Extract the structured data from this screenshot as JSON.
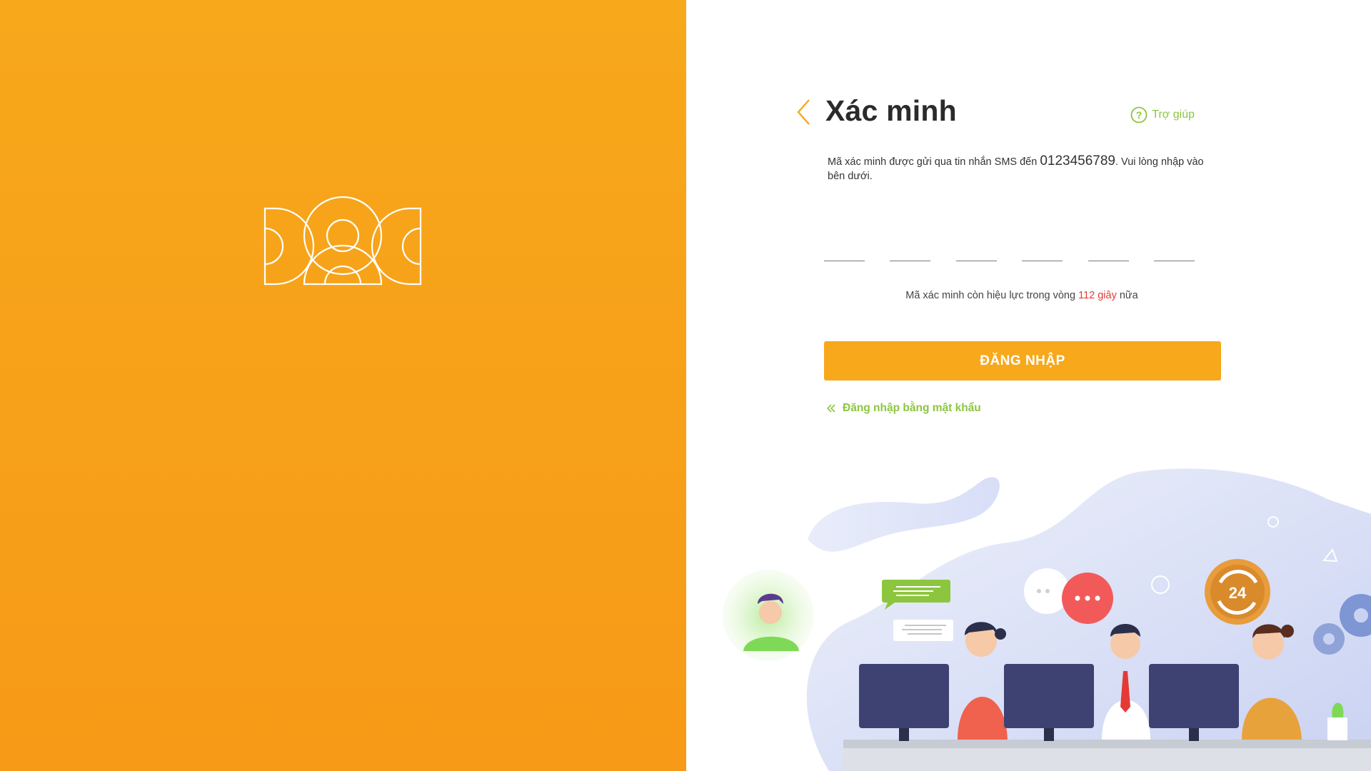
{
  "header": {
    "title": "Xác minh",
    "help_label": "Trợ giúp"
  },
  "message": {
    "before_phone": "Mã xác minh được gửi qua tin nhắn SMS đến ",
    "phone": "0123456789",
    "after_phone": ". Vui lòng nhập vào bên dưới."
  },
  "otp": {
    "digits": [
      "",
      "",
      "",
      "",
      "",
      ""
    ]
  },
  "timer": {
    "prefix": "Mã xác minh còn hiệu lực trong vòng ",
    "seconds": "112 giây",
    "suffix": " nữa"
  },
  "login_button": "ĐĂNG NHẬP",
  "password_link": "Đăng nhập bằng mật khẩu",
  "colors": {
    "brand_orange": "#f7a81b",
    "accent_green": "#8cc63f",
    "countdown_red": "#e53935"
  },
  "icons": {
    "back": "chevron-left-icon",
    "help": "question-circle-icon",
    "password_link": "double-chevron-left-icon",
    "badge_24": "24-hours-icon"
  },
  "illustration": {
    "badge_text": "24"
  }
}
